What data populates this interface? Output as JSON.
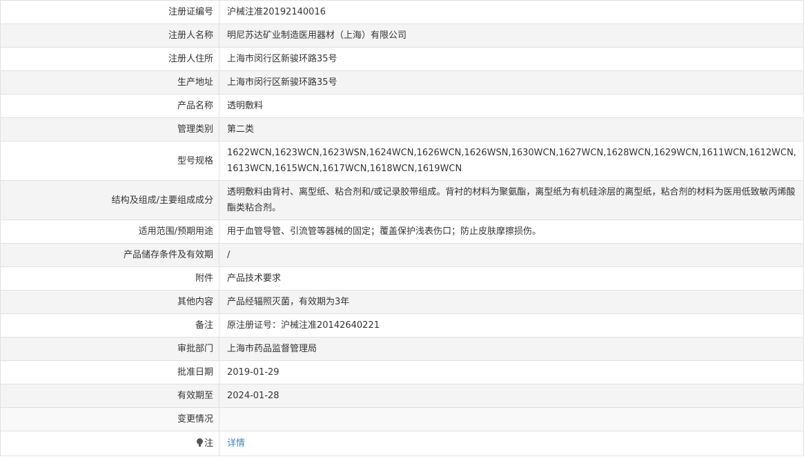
{
  "rows": [
    {
      "label": "注册证编号",
      "value": "沪械注准20192140016"
    },
    {
      "label": "注册人名称",
      "value": "明尼苏达矿业制造医用器材（上海）有限公司"
    },
    {
      "label": "注册人住所",
      "value": "上海市闵行区新骏环路35号"
    },
    {
      "label": "生产地址",
      "value": "上海市闵行区新骏环路35号"
    },
    {
      "label": "产品名称",
      "value": "透明敷料"
    },
    {
      "label": "管理类别",
      "value": "第二类"
    },
    {
      "label": "型号规格",
      "value": "1622WCN,1623WCN,1623WSN,1624WCN,1626WCN,1626WSN,1630WCN,1627WCN,1628WCN,1629WCN,1611WCN,1612WCN,1613WCN,1615WCN,1617WCN,1618WCN,1619WCN"
    },
    {
      "label": "结构及组成/主要组成成分",
      "value": "透明敷料由背衬、离型纸、粘合剂和/或记录胶带组成。背衬的材料为聚氨酯，离型纸为有机硅涂层的离型纸，粘合剂的材料为医用低致敏丙烯酸酯类粘合剂。"
    },
    {
      "label": "适用范围/预期用途",
      "value": "用于血管导管、引流管等器械的固定；覆盖保护浅表伤口；防止皮肤摩擦损伤。"
    },
    {
      "label": "产品储存条件及有效期",
      "value": "/"
    },
    {
      "label": "附件",
      "value": "产品技术要求"
    },
    {
      "label": "其他内容",
      "value": "产品经辐照灭菌，有效期为3年"
    },
    {
      "label": "备注",
      "value": "原注册证号：沪械注准20142640221"
    },
    {
      "label": "审批部门",
      "value": "上海市药品监督管理局"
    },
    {
      "label": "批准日期",
      "value": "2019-01-29"
    },
    {
      "label": "有效期至",
      "value": "2024-01-28"
    },
    {
      "label": "变更情况",
      "value": ""
    }
  ],
  "note_row": {
    "label": "注",
    "icon": "lightbulb-icon",
    "link_text": "详情",
    "link_color": "#3a85c6"
  }
}
